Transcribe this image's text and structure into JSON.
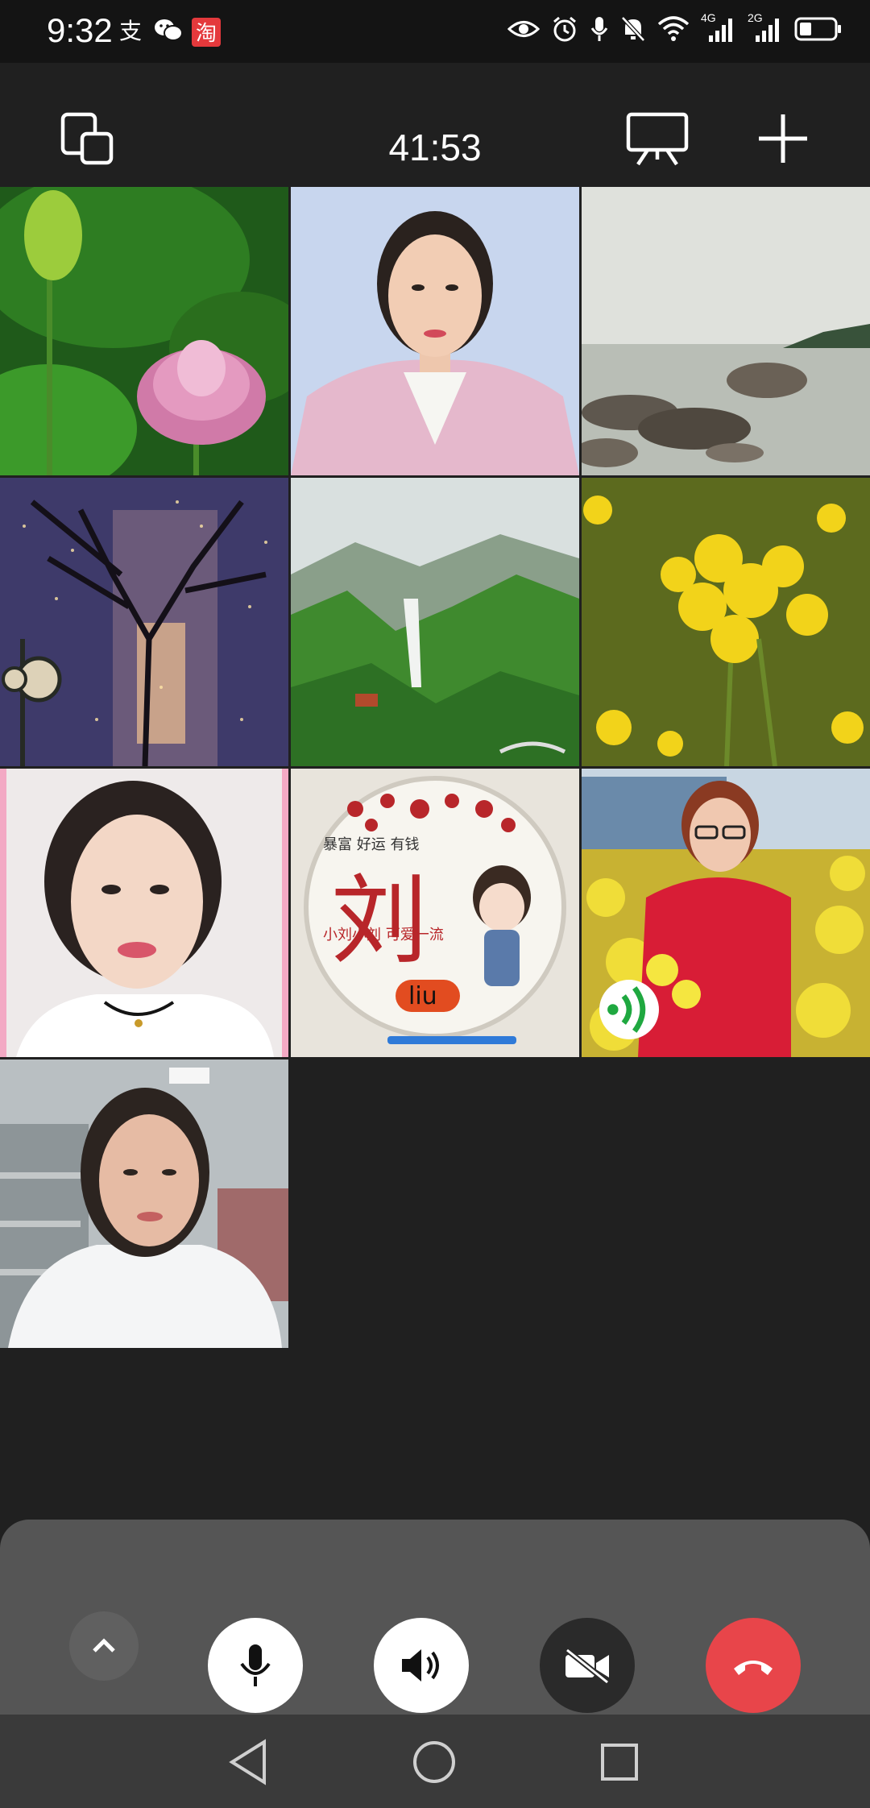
{
  "status_bar": {
    "time": "9:32",
    "left_icons": [
      "alipay-icon",
      "wechat-icon",
      "taobao-icon"
    ],
    "right_icons": [
      "eye-icon",
      "alarm-icon",
      "mic-icon",
      "mute-bell-icon",
      "wifi-icon",
      "signal-4g-icon",
      "signal-2g-icon",
      "battery-icon"
    ],
    "network_1": "4G",
    "network_2": "2G",
    "taobao_glyph": "淘"
  },
  "toolbar": {
    "timer": "41:53",
    "icons": [
      "minimize-window-icon",
      "screen-share-icon",
      "add-participant-icon"
    ]
  },
  "participants": [
    {
      "id": 1,
      "avatar": "lotus-flower"
    },
    {
      "id": 2,
      "avatar": "woman-portrait-pink-suit"
    },
    {
      "id": 3,
      "avatar": "seaside-rocks"
    },
    {
      "id": 4,
      "avatar": "night-tree-clock"
    },
    {
      "id": 5,
      "avatar": "mountain-waterfall"
    },
    {
      "id": 6,
      "avatar": "yellow-rapeseed-flowers"
    },
    {
      "id": 7,
      "avatar": "woman-selfie-video"
    },
    {
      "id": 8,
      "avatar": "liu-cartoon-badge",
      "badge_text": {
        "top": "暴富 好运 有钱",
        "main": "刘",
        "slogan": "小刘小刘 可爱一流",
        "name": "liu"
      }
    },
    {
      "id": 9,
      "avatar": "woman-red-jacket-flowers",
      "speaking": true
    },
    {
      "id": 10,
      "avatar": "woman-white-hoodie-video"
    }
  ],
  "controls": {
    "buttons": [
      "expand-up-icon",
      "microphone-icon",
      "speaker-icon",
      "camera-off-icon",
      "hang-up-icon"
    ],
    "colors": {
      "panel": "#555555",
      "white": "#ffffff",
      "camera_off_bg": "#2a2a2a",
      "hangup": "#e8454a"
    }
  }
}
